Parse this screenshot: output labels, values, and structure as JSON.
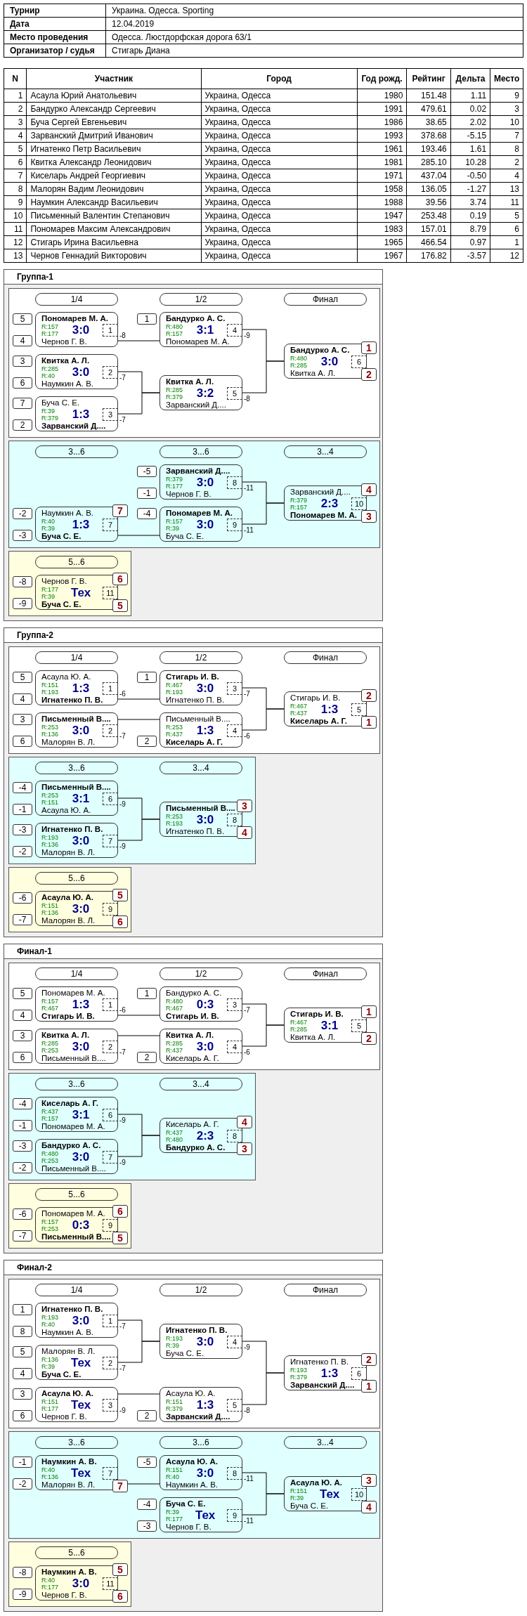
{
  "info": [
    {
      "label": "Турнир",
      "value": "Украина. Одесса. Sporting"
    },
    {
      "label": "Дата",
      "value": "12.04.2019"
    },
    {
      "label": "Место проведения",
      "value": "Одесса. Люстдорфская дорога 63/1"
    },
    {
      "label": "Организатор / судья",
      "value": "Стигарь Диана"
    }
  ],
  "participants": {
    "columns": [
      "N",
      "Участник",
      "Город",
      "Год рожд.",
      "Рейтинг",
      "Дельта",
      "Место"
    ],
    "rows": [
      [
        "1",
        "Асаула Юрий Анатольевич",
        "Украина, Одесса",
        "1980",
        "151.48",
        "1.11",
        "9"
      ],
      [
        "2",
        "Бандурко Александр Сергеевич",
        "Украина, Одесса",
        "1991",
        "479.61",
        "0.02",
        "3"
      ],
      [
        "3",
        "Буча Сергей Евгеньевич",
        "Украина, Одесса",
        "1986",
        "38.65",
        "2.02",
        "10"
      ],
      [
        "4",
        "Зарванский Дмитрий Иванович",
        "Украина, Одесса",
        "1993",
        "378.68",
        "-5.15",
        "7"
      ],
      [
        "5",
        "Игнатенко Петр Васильевич",
        "Украина, Одесса",
        "1961",
        "193.46",
        "1.61",
        "8"
      ],
      [
        "6",
        "Квитка Александр Леонидович",
        "Украина, Одесса",
        "1981",
        "285.10",
        "10.28",
        "2"
      ],
      [
        "7",
        "Киселарь Андрей Георгиевич",
        "Украина, Одесса",
        "1971",
        "437.04",
        "-0.50",
        "4"
      ],
      [
        "8",
        "Малорян Вадим Леонидович",
        "Украина, Одесса",
        "1958",
        "136.05",
        "-1.27",
        "13"
      ],
      [
        "9",
        "Наумкин Александр Васильевич",
        "Украина, Одесса",
        "1988",
        "39.56",
        "3.74",
        "11"
      ],
      [
        "10",
        "Письменный Валентин Степанович",
        "Украина, Одесса",
        "1947",
        "253.48",
        "0.19",
        "5"
      ],
      [
        "11",
        "Пономарев Максим Александрович",
        "Украина, Одесса",
        "1983",
        "157.01",
        "8.79",
        "6"
      ],
      [
        "12",
        "Стигарь Ирина Васильевна",
        "Украина, Одесса",
        "1965",
        "466.54",
        "0.97",
        "1"
      ],
      [
        "13",
        "Чернов Геннадий Викторович",
        "Украина, Одесса",
        "1967",
        "176.82",
        "-3.57",
        "12"
      ]
    ]
  },
  "sections": [
    {
      "title": "Группа-1",
      "panels": [
        {
          "kind": "main",
          "headers": [
            "1/4",
            "1/2",
            "Финал"
          ],
          "tree": [
            {
              "number": "6",
              "score": "3:0",
              "top": {
                "name": "Бандурко А. С.",
                "rating": "R:480",
                "winner": true,
                "place": "1"
              },
              "bottom": {
                "name": "Квитка А. Л.",
                "rating": "R:285",
                "winner": false,
                "place": "2"
              },
              "children": [
                {
                  "number": "4",
                  "score": "3:1",
                  "loser_to": "-9",
                  "top": {
                    "seed": "1",
                    "name": "Бандурко А. С.",
                    "rating": "R:480",
                    "winner": true
                  },
                  "bottom": {
                    "name": "Пономарев М. А.",
                    "rating": "R:157",
                    "winner": false
                  },
                  "children": [
                    {
                      "number": "1",
                      "score": "3:0",
                      "loser_to": "-8",
                      "top": {
                        "seed": "5",
                        "name": "Пономарев М. А.",
                        "rating": "R:157",
                        "winner": true
                      },
                      "bottom": {
                        "seed": "4",
                        "name": "Чернов Г. В.",
                        "rating": "R:177",
                        "winner": false
                      }
                    }
                  ]
                },
                {
                  "number": "5",
                  "score": "3:2",
                  "loser_to": "-8",
                  "top": {
                    "name": "Квитка А. Л.",
                    "rating": "R:285",
                    "winner": true
                  },
                  "bottom": {
                    "name": "Зарванский Д....",
                    "rating": "R:379",
                    "winner": false
                  },
                  "children": [
                    {
                      "number": "2",
                      "score": "3:0",
                      "loser_to": "-7",
                      "top": {
                        "seed": "3",
                        "name": "Квитка А. Л.",
                        "rating": "R:285",
                        "winner": true
                      },
                      "bottom": {
                        "seed": "6",
                        "name": "Наумкин А. В.",
                        "rating": "R:40",
                        "winner": false
                      }
                    },
                    {
                      "number": "3",
                      "score": "1:3",
                      "loser_to": "-7",
                      "top": {
                        "seed": "7",
                        "name": "Буча С. Е.",
                        "rating": "R:39",
                        "winner": false
                      },
                      "bottom": {
                        "seed": "2",
                        "name": "Зарванский Д....",
                        "rating": "R:379",
                        "winner": true
                      }
                    }
                  ]
                }
              ]
            }
          ]
        },
        {
          "kind": "consolation",
          "headers": [
            "3...6",
            "3...6",
            "3...4"
          ],
          "tree": [
            {
              "number": "10",
              "score": "2:3",
              "top": {
                "name": "Зарванский Д....",
                "rating": "R:379",
                "winner": false,
                "place": "4"
              },
              "bottom": {
                "name": "Пономарев М. А.",
                "rating": "R:157",
                "winner": true,
                "place": "3"
              },
              "children": [
                {
                  "number": "8",
                  "score": "3:0",
                  "loser_to": "-11",
                  "top": {
                    "seed": "-5",
                    "name": "Зарванский Д....",
                    "rating": "R:379",
                    "winner": true
                  },
                  "bottom": {
                    "seed": "-1",
                    "name": "Чернов Г. В.",
                    "rating": "R:177",
                    "winner": false
                  }
                },
                {
                  "number": "9",
                  "score": "3:0",
                  "loser_to": "-11",
                  "top": {
                    "seed": "-4",
                    "name": "Пономарев М. А.",
                    "rating": "R:157",
                    "winner": true
                  },
                  "bottom": {
                    "name": "Буча С. Е.",
                    "rating": "R:39",
                    "winner": false
                  },
                  "children": [
                    {
                      "number": "7",
                      "score": "1:3",
                      "top": {
                        "seed": "-2",
                        "name": "Наумкин А. В.",
                        "rating": "R:40",
                        "winner": false,
                        "place": "7"
                      },
                      "bottom": {
                        "seed": "-3",
                        "name": "Буча С. Е.",
                        "rating": "R:39",
                        "winner": true
                      }
                    }
                  ]
                }
              ]
            }
          ]
        },
        {
          "kind": "placement",
          "headers": [
            "5...6"
          ],
          "tree": [
            {
              "number": "11",
              "score": "Тех",
              "top": {
                "seed": "-8",
                "name": "Чернов Г. В.",
                "rating": "R:177",
                "winner": false,
                "place": "6"
              },
              "bottom": {
                "seed": "-9",
                "name": "Буча С. Е.",
                "rating": "R:39",
                "winner": true,
                "place": "5"
              }
            }
          ]
        }
      ]
    },
    {
      "title": "Группа-2",
      "panels": [
        {
          "kind": "main",
          "headers": [
            "1/4",
            "1/2",
            "Финал"
          ],
          "tree": [
            {
              "number": "5",
              "score": "1:3",
              "top": {
                "name": "Стигарь И. В.",
                "rating": "R:467",
                "winner": false,
                "place": "2"
              },
              "bottom": {
                "name": "Киселарь А. Г.",
                "rating": "R:437",
                "winner": true,
                "place": "1"
              },
              "children": [
                {
                  "number": "3",
                  "score": "3:0",
                  "loser_to": "-7",
                  "top": {
                    "seed": "1",
                    "name": "Стигарь И. В.",
                    "rating": "R:467",
                    "winner": true
                  },
                  "bottom": {
                    "name": "Игнатенко П. В.",
                    "rating": "R:193",
                    "winner": false
                  },
                  "children": [
                    {
                      "number": "1",
                      "score": "1:3",
                      "loser_to": "-6",
                      "top": {
                        "seed": "5",
                        "name": "Асаула Ю. А.",
                        "rating": "R:151",
                        "winner": false
                      },
                      "bottom": {
                        "seed": "4",
                        "name": "Игнатенко П. В.",
                        "rating": "R:193",
                        "winner": true
                      }
                    }
                  ]
                },
                {
                  "number": "4",
                  "score": "1:3",
                  "loser_to": "-6",
                  "top": {
                    "name": "Письменный В....",
                    "rating": "R:253",
                    "winner": false
                  },
                  "bottom": {
                    "seed": "2",
                    "name": "Киселарь А. Г.",
                    "rating": "R:437",
                    "winner": true
                  },
                  "children": [
                    {
                      "number": "2",
                      "score": "3:0",
                      "loser_to": "-7",
                      "top": {
                        "seed": "3",
                        "name": "Письменный В....",
                        "rating": "R:253",
                        "winner": true
                      },
                      "bottom": {
                        "seed": "6",
                        "name": "Малорян В. Л.",
                        "rating": "R:136",
                        "winner": false
                      }
                    }
                  ]
                }
              ]
            }
          ]
        },
        {
          "kind": "consolation",
          "headers": [
            "3...6",
            "3...4"
          ],
          "tree": [
            {
              "number": "8",
              "score": "3:0",
              "top": {
                "name": "Письменный В....",
                "rating": "R:253",
                "winner": true,
                "place": "3"
              },
              "bottom": {
                "name": "Игнатенко П. В.",
                "rating": "R:193",
                "winner": false,
                "place": "4"
              },
              "children": [
                {
                  "number": "6",
                  "score": "3:1",
                  "loser_to": "-9",
                  "top": {
                    "seed": "-4",
                    "name": "Письменный В....",
                    "rating": "R:253",
                    "winner": true
                  },
                  "bottom": {
                    "seed": "-1",
                    "name": "Асаула Ю. А.",
                    "rating": "R:151",
                    "winner": false
                  }
                },
                {
                  "number": "7",
                  "score": "3:0",
                  "loser_to": "-9",
                  "top": {
                    "seed": "-3",
                    "name": "Игнатенко П. В.",
                    "rating": "R:193",
                    "winner": true
                  },
                  "bottom": {
                    "seed": "-2",
                    "name": "Малорян В. Л.",
                    "rating": "R:136",
                    "winner": false
                  }
                }
              ]
            }
          ]
        },
        {
          "kind": "placement",
          "headers": [
            "5...6"
          ],
          "tree": [
            {
              "number": "9",
              "score": "3:0",
              "top": {
                "seed": "-6",
                "name": "Асаула Ю. А.",
                "rating": "R:151",
                "winner": true,
                "place": "5"
              },
              "bottom": {
                "seed": "-7",
                "name": "Малорян В. Л.",
                "rating": "R:136",
                "winner": false,
                "place": "6"
              }
            }
          ]
        }
      ]
    },
    {
      "title": "Финал-1",
      "panels": [
        {
          "kind": "main",
          "headers": [
            "1/4",
            "1/2",
            "Финал"
          ],
          "tree": [
            {
              "number": "5",
              "score": "3:1",
              "top": {
                "name": "Стигарь И. В.",
                "rating": "R:467",
                "winner": true,
                "place": "1"
              },
              "bottom": {
                "name": "Квитка А. Л.",
                "rating": "R:285",
                "winner": false,
                "place": "2"
              },
              "children": [
                {
                  "number": "3",
                  "score": "0:3",
                  "loser_to": "-7",
                  "top": {
                    "seed": "1",
                    "name": "Бандурко А. С.",
                    "rating": "R:480",
                    "winner": false
                  },
                  "bottom": {
                    "name": "Стигарь И. В.",
                    "rating": "R:467",
                    "winner": true
                  },
                  "children": [
                    {
                      "number": "1",
                      "score": "1:3",
                      "loser_to": "-6",
                      "top": {
                        "seed": "5",
                        "name": "Пономарев М. А.",
                        "rating": "R:157",
                        "winner": false
                      },
                      "bottom": {
                        "seed": "4",
                        "name": "Стигарь И. В.",
                        "rating": "R:467",
                        "winner": true
                      }
                    }
                  ]
                },
                {
                  "number": "4",
                  "score": "3:0",
                  "loser_to": "-6",
                  "top": {
                    "name": "Квитка А. Л.",
                    "rating": "R:285",
                    "winner": true
                  },
                  "bottom": {
                    "seed": "2",
                    "name": "Киселарь А. Г.",
                    "rating": "R:437",
                    "winner": false
                  },
                  "children": [
                    {
                      "number": "2",
                      "score": "3:0",
                      "loser_to": "-7",
                      "top": {
                        "seed": "3",
                        "name": "Квитка А. Л.",
                        "rating": "R:285",
                        "winner": true
                      },
                      "bottom": {
                        "seed": "6",
                        "name": "Письменный В....",
                        "rating": "R:253",
                        "winner": false
                      }
                    }
                  ]
                }
              ]
            }
          ]
        },
        {
          "kind": "consolation",
          "headers": [
            "3...6",
            "3...4"
          ],
          "tree": [
            {
              "number": "8",
              "score": "2:3",
              "top": {
                "name": "Киселарь А. Г.",
                "rating": "R:437",
                "winner": false,
                "place": "4"
              },
              "bottom": {
                "name": "Бандурко А. С.",
                "rating": "R:480",
                "winner": true,
                "place": "3"
              },
              "children": [
                {
                  "number": "6",
                  "score": "3:1",
                  "loser_to": "-9",
                  "top": {
                    "seed": "-4",
                    "name": "Киселарь А. Г.",
                    "rating": "R:437",
                    "winner": true
                  },
                  "bottom": {
                    "seed": "-1",
                    "name": "Пономарев М. А.",
                    "rating": "R:157",
                    "winner": false
                  }
                },
                {
                  "number": "7",
                  "score": "3:0",
                  "loser_to": "-9",
                  "top": {
                    "seed": "-3",
                    "name": "Бандурко А. С.",
                    "rating": "R:480",
                    "winner": true
                  },
                  "bottom": {
                    "seed": "-2",
                    "name": "Письменный В....",
                    "rating": "R:253",
                    "winner": false
                  }
                }
              ]
            }
          ]
        },
        {
          "kind": "placement",
          "headers": [
            "5...6"
          ],
          "tree": [
            {
              "number": "9",
              "score": "0:3",
              "top": {
                "seed": "-6",
                "name": "Пономарев М. А.",
                "rating": "R:157",
                "winner": false,
                "place": "6"
              },
              "bottom": {
                "seed": "-7",
                "name": "Письменный В....",
                "rating": "R:253",
                "winner": true,
                "place": "5"
              }
            }
          ]
        }
      ]
    },
    {
      "title": "Финал-2",
      "panels": [
        {
          "kind": "main",
          "headers": [
            "1/4",
            "1/2",
            "Финал"
          ],
          "tree": [
            {
              "number": "6",
              "score": "1:3",
              "top": {
                "name": "Игнатенко П. В.",
                "rating": "R:193",
                "winner": false,
                "place": "2"
              },
              "bottom": {
                "name": "Зарванский Д....",
                "rating": "R:379",
                "winner": true,
                "place": "1"
              },
              "children": [
                {
                  "number": "4",
                  "score": "3:0",
                  "loser_to": "-9",
                  "top": {
                    "name": "Игнатенко П. В.",
                    "rating": "R:193",
                    "winner": true
                  },
                  "bottom": {
                    "name": "Буча С. Е.",
                    "rating": "R:39",
                    "winner": false
                  },
                  "children": [
                    {
                      "number": "1",
                      "score": "3:0",
                      "loser_to": "-7",
                      "top": {
                        "seed": "1",
                        "name": "Игнатенко П. В.",
                        "rating": "R:193",
                        "winner": true
                      },
                      "bottom": {
                        "seed": "8",
                        "name": "Наумкин А. В.",
                        "rating": "R:40",
                        "winner": false
                      }
                    },
                    {
                      "number": "2",
                      "score": "Тех",
                      "loser_to": "-7",
                      "top": {
                        "seed": "5",
                        "name": "Малорян В. Л.",
                        "rating": "R:136",
                        "winner": false
                      },
                      "bottom": {
                        "seed": "4",
                        "name": "Буча С. Е.",
                        "rating": "R:39",
                        "winner": true
                      }
                    }
                  ]
                },
                {
                  "number": "5",
                  "score": "1:3",
                  "loser_to": "-8",
                  "top": {
                    "name": "Асаула Ю. А.",
                    "rating": "R:151",
                    "winner": false
                  },
                  "bottom": {
                    "seed": "2",
                    "name": "Зарванский Д....",
                    "rating": "R:379",
                    "winner": true
                  },
                  "children": [
                    {
                      "number": "3",
                      "score": "Тех",
                      "loser_to": "-9",
                      "top": {
                        "seed": "3",
                        "name": "Асаула Ю. А.",
                        "rating": "R:151",
                        "winner": true
                      },
                      "bottom": {
                        "seed": "6",
                        "name": "Чернов Г. В.",
                        "rating": "R:177",
                        "winner": false
                      }
                    }
                  ]
                }
              ]
            }
          ]
        },
        {
          "kind": "consolation",
          "headers": [
            "3...6",
            "3...6",
            "3...4"
          ],
          "tree": [
            {
              "number": "10",
              "score": "Тех",
              "top": {
                "name": "Асаула Ю. А.",
                "rating": "R:151",
                "winner": true,
                "place": "3"
              },
              "bottom": {
                "name": "Буча С. Е.",
                "rating": "R:39",
                "winner": false,
                "place": "4"
              },
              "children": [
                {
                  "number": "8",
                  "score": "3:0",
                  "loser_to": "-11",
                  "top": {
                    "seed": "-5",
                    "name": "Асаула Ю. А.",
                    "rating": "R:151",
                    "winner": true
                  },
                  "bottom": {
                    "name": "Наумкин А. В.",
                    "rating": "R:40",
                    "winner": false
                  },
                  "children": [
                    {
                      "number": "7",
                      "score": "Тех",
                      "top": {
                        "seed": "-1",
                        "name": "Наумкин А. В.",
                        "rating": "R:40",
                        "winner": true
                      },
                      "bottom": {
                        "seed": "-2",
                        "name": "Малорян В. Л.",
                        "rating": "R:136",
                        "winner": false,
                        "place": "7"
                      }
                    }
                  ]
                },
                {
                  "number": "9",
                  "score": "Тех",
                  "loser_to": "-11",
                  "top": {
                    "seed": "-4",
                    "name": "Буча С. Е.",
                    "rating": "R:39",
                    "winner": true
                  },
                  "bottom": {
                    "seed": "-3",
                    "name": "Чернов Г. В.",
                    "rating": "R:177",
                    "winner": false
                  }
                }
              ]
            }
          ]
        },
        {
          "kind": "placement",
          "headers": [
            "5...6"
          ],
          "tree": [
            {
              "number": "11",
              "score": "3:0",
              "top": {
                "seed": "-8",
                "name": "Наумкин А. В.",
                "rating": "R:40",
                "winner": true,
                "place": "5"
              },
              "bottom": {
                "seed": "-9",
                "name": "Чернов Г. В.",
                "rating": "R:177",
                "winner": false,
                "place": "6"
              }
            }
          ]
        }
      ]
    }
  ]
}
